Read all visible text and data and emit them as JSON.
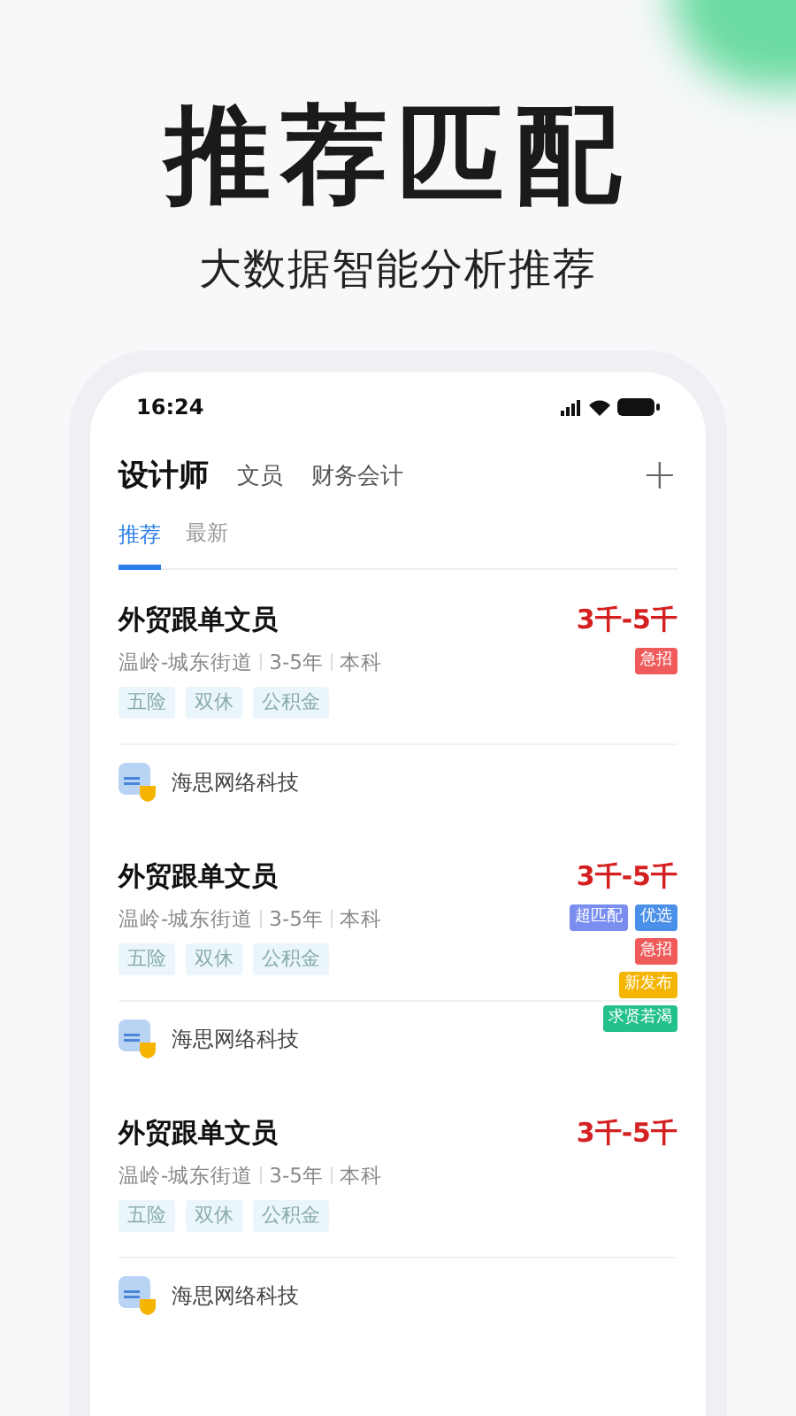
{
  "headline": "推荐匹配",
  "subtitle": "大数据智能分析推荐",
  "status_bar": {
    "time": "16:24"
  },
  "category_tabs": [
    {
      "label": "设计师",
      "selected": true
    },
    {
      "label": "文员",
      "selected": false
    },
    {
      "label": "财务会计",
      "selected": false
    }
  ],
  "add_button": "+",
  "sort_tabs": [
    {
      "label": "推荐",
      "selected": true
    },
    {
      "label": "最新",
      "selected": false
    }
  ],
  "jobs": [
    {
      "title": "外贸跟单文员",
      "salary": "3千-5千",
      "location": "温岭-城东街道",
      "experience": "3-5年",
      "education": "本科",
      "benefits": [
        "五险",
        "双休",
        "公积金"
      ],
      "company": "海思网络科技",
      "badges": [
        {
          "label": "急招",
          "color": "#ef5b5b"
        }
      ]
    },
    {
      "title": "外贸跟单文员",
      "salary": "3千-5千",
      "location": "温岭-城东街道",
      "experience": "3-5年",
      "education": "本科",
      "benefits": [
        "五险",
        "双休",
        "公积金"
      ],
      "company": "海思网络科技",
      "badges": [
        {
          "label": "超匹配",
          "color": "#7a8ef0"
        },
        {
          "label": "优选",
          "color": "#4a90e8"
        },
        {
          "label": "急招",
          "color": "#ef5b5b"
        },
        {
          "label": "新发布",
          "color": "#f5b400"
        },
        {
          "label": "求贤若渴",
          "color": "#22c08a"
        }
      ]
    },
    {
      "title": "外贸跟单文员",
      "salary": "3千-5千",
      "location": "温岭-城东街道",
      "experience": "3-5年",
      "education": "本科",
      "benefits": [
        "五险",
        "双休",
        "公积金"
      ],
      "company": "海思网络科技"
    }
  ]
}
